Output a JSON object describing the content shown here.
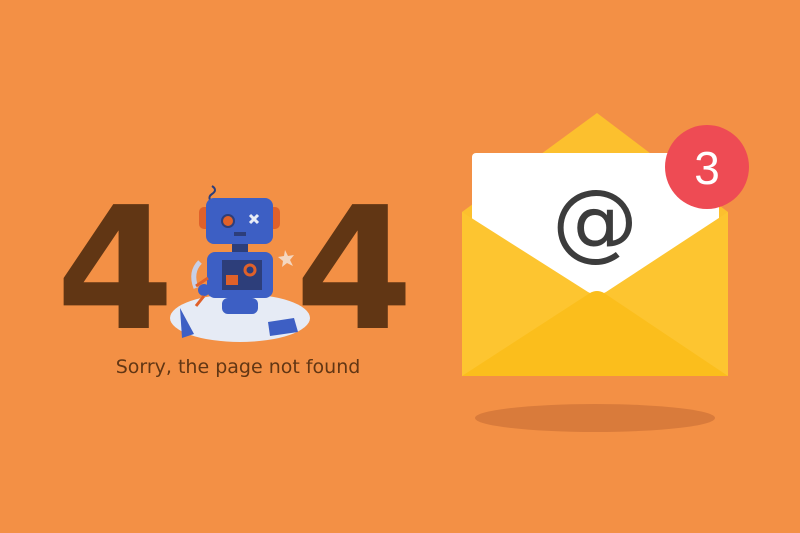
{
  "error": {
    "digit_left": "4",
    "digit_right": "4",
    "message": "Sorry, the page not found"
  },
  "mail": {
    "symbol": "@",
    "badge_count": "3"
  },
  "icons": [
    "robot-icon",
    "envelope-icon",
    "notification-badge"
  ],
  "colors": {
    "background": "#f39045",
    "digits": "#613614",
    "robot": "#3d5fc4",
    "envelope": "#fdc530",
    "badge": "#ee4b54"
  }
}
